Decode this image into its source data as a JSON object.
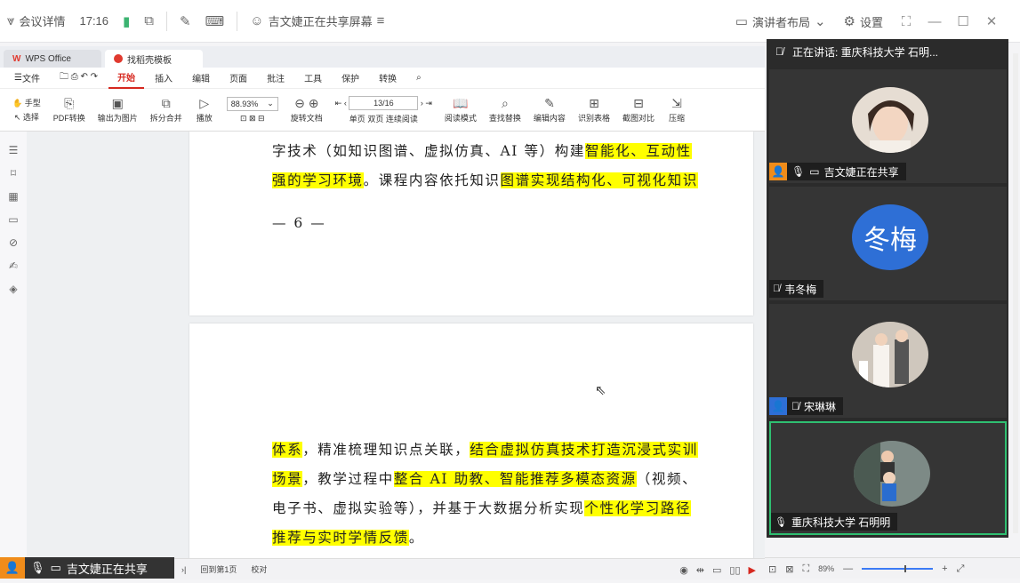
{
  "meeting": {
    "details_label": "会议详情",
    "time": "17:16",
    "sharing_title": "吉文婕正在共享屏幕",
    "layout_label": "演讲者布局",
    "settings_label": "设置"
  },
  "wps": {
    "tabs": [
      {
        "label": "WPS Office"
      },
      {
        "label": "找稻壳模板"
      }
    ],
    "file_menu": "文件",
    "menu": [
      "开始",
      "插入",
      "编辑",
      "页面",
      "批注",
      "工具",
      "保护",
      "转换"
    ],
    "ribbon": {
      "hand": "手型",
      "select": "选择",
      "pdf_convert": "PDF转换",
      "export_image": "输出为图片",
      "split_merge": "拆分合并",
      "play": "播放",
      "zoom_value": "88.93%",
      "page_value": "13/16",
      "rotate": "旋转文档",
      "single": "单页",
      "double": "双页",
      "continuous": "连续阅读",
      "read_mode": "阅读模式",
      "find_replace": "查找替换",
      "edit_content": "编辑内容",
      "recognize_table": "识别表格",
      "compare": "截图对比",
      "compress": "压缩"
    },
    "page1_lines": [
      [
        {
          "t": "字技术（如知识图谱、虚拟仿真、AI 等）构建"
        },
        {
          "t": "智能化、互动性",
          "h": true
        }
      ],
      [
        {
          "t": "强的学习环境",
          "h": true
        },
        {
          "t": "。课程内容依托知识"
        },
        {
          "t": "图谱实现结构化、可视化知识",
          "h": true
        }
      ]
    ],
    "page_number": "— 6 —",
    "page2_lines": [
      [
        {
          "t": "体系",
          "h": true
        },
        {
          "t": "，精准梳理知识点关联，"
        },
        {
          "t": "结合虚拟仿真技术打造沉浸式实训",
          "h": true
        }
      ],
      [
        {
          "t": "场景",
          "h": true
        },
        {
          "t": "，教学过程中"
        },
        {
          "t": "整合 AI 助教、智能推荐多模态资源",
          "h": true
        },
        {
          "t": "（视频、"
        }
      ],
      [
        {
          "t": "电子书、虚拟实验等），并基于大数据分析实现"
        },
        {
          "t": "个性化学习路径",
          "h": true
        }
      ],
      [
        {
          "t": "推荐与实时学情反馈",
          "h": true
        },
        {
          "t": "。"
        }
      ]
    ],
    "status": {
      "back_first": "回到第1页",
      "proofread": "校对",
      "zoom_percent": "89%"
    }
  },
  "sharing_badge": "吉文婕正在共享",
  "panel": {
    "speaking": "正在讲话:  重庆科技大学 石明...",
    "participants": [
      {
        "name": "吉文婕正在共享",
        "avatar_text": ""
      },
      {
        "name": "韦冬梅",
        "avatar_text": "冬梅"
      },
      {
        "name": "宋琳琳",
        "avatar_text": ""
      },
      {
        "name": "重庆科技大学 石明明",
        "avatar_text": ""
      }
    ]
  }
}
